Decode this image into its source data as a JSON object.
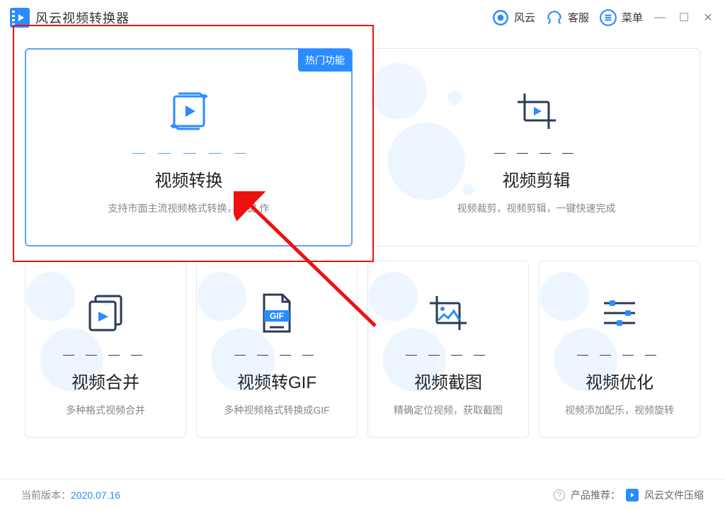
{
  "app": {
    "title": "风云视频转换器"
  },
  "header": {
    "brand": "风云",
    "support": "客服",
    "menu": "菜单"
  },
  "cards": {
    "convert": {
      "badge": "热门功能",
      "title": "视频转换",
      "desc": "支持市面主流视频格式转换，一键    作"
    },
    "edit": {
      "title": "视频剪辑",
      "desc": "视频裁剪，视频剪辑，一键快速完成"
    },
    "merge": {
      "title": "视频合并",
      "desc": "多种格式视频合并"
    },
    "gif": {
      "title": "视频转GIF",
      "desc": "多种视频格式转换成GIF",
      "icon_label": "GIF"
    },
    "shot": {
      "title": "视频截图",
      "desc": "精确定位视频，获取截图"
    },
    "opt": {
      "title": "视频优化",
      "desc": "视频添加配乐，视频旋转"
    }
  },
  "footer": {
    "version_label": "当前版本：",
    "version": "2020.07.16",
    "recommend_label": "产品推荐：",
    "recommend": "风云文件压缩"
  }
}
